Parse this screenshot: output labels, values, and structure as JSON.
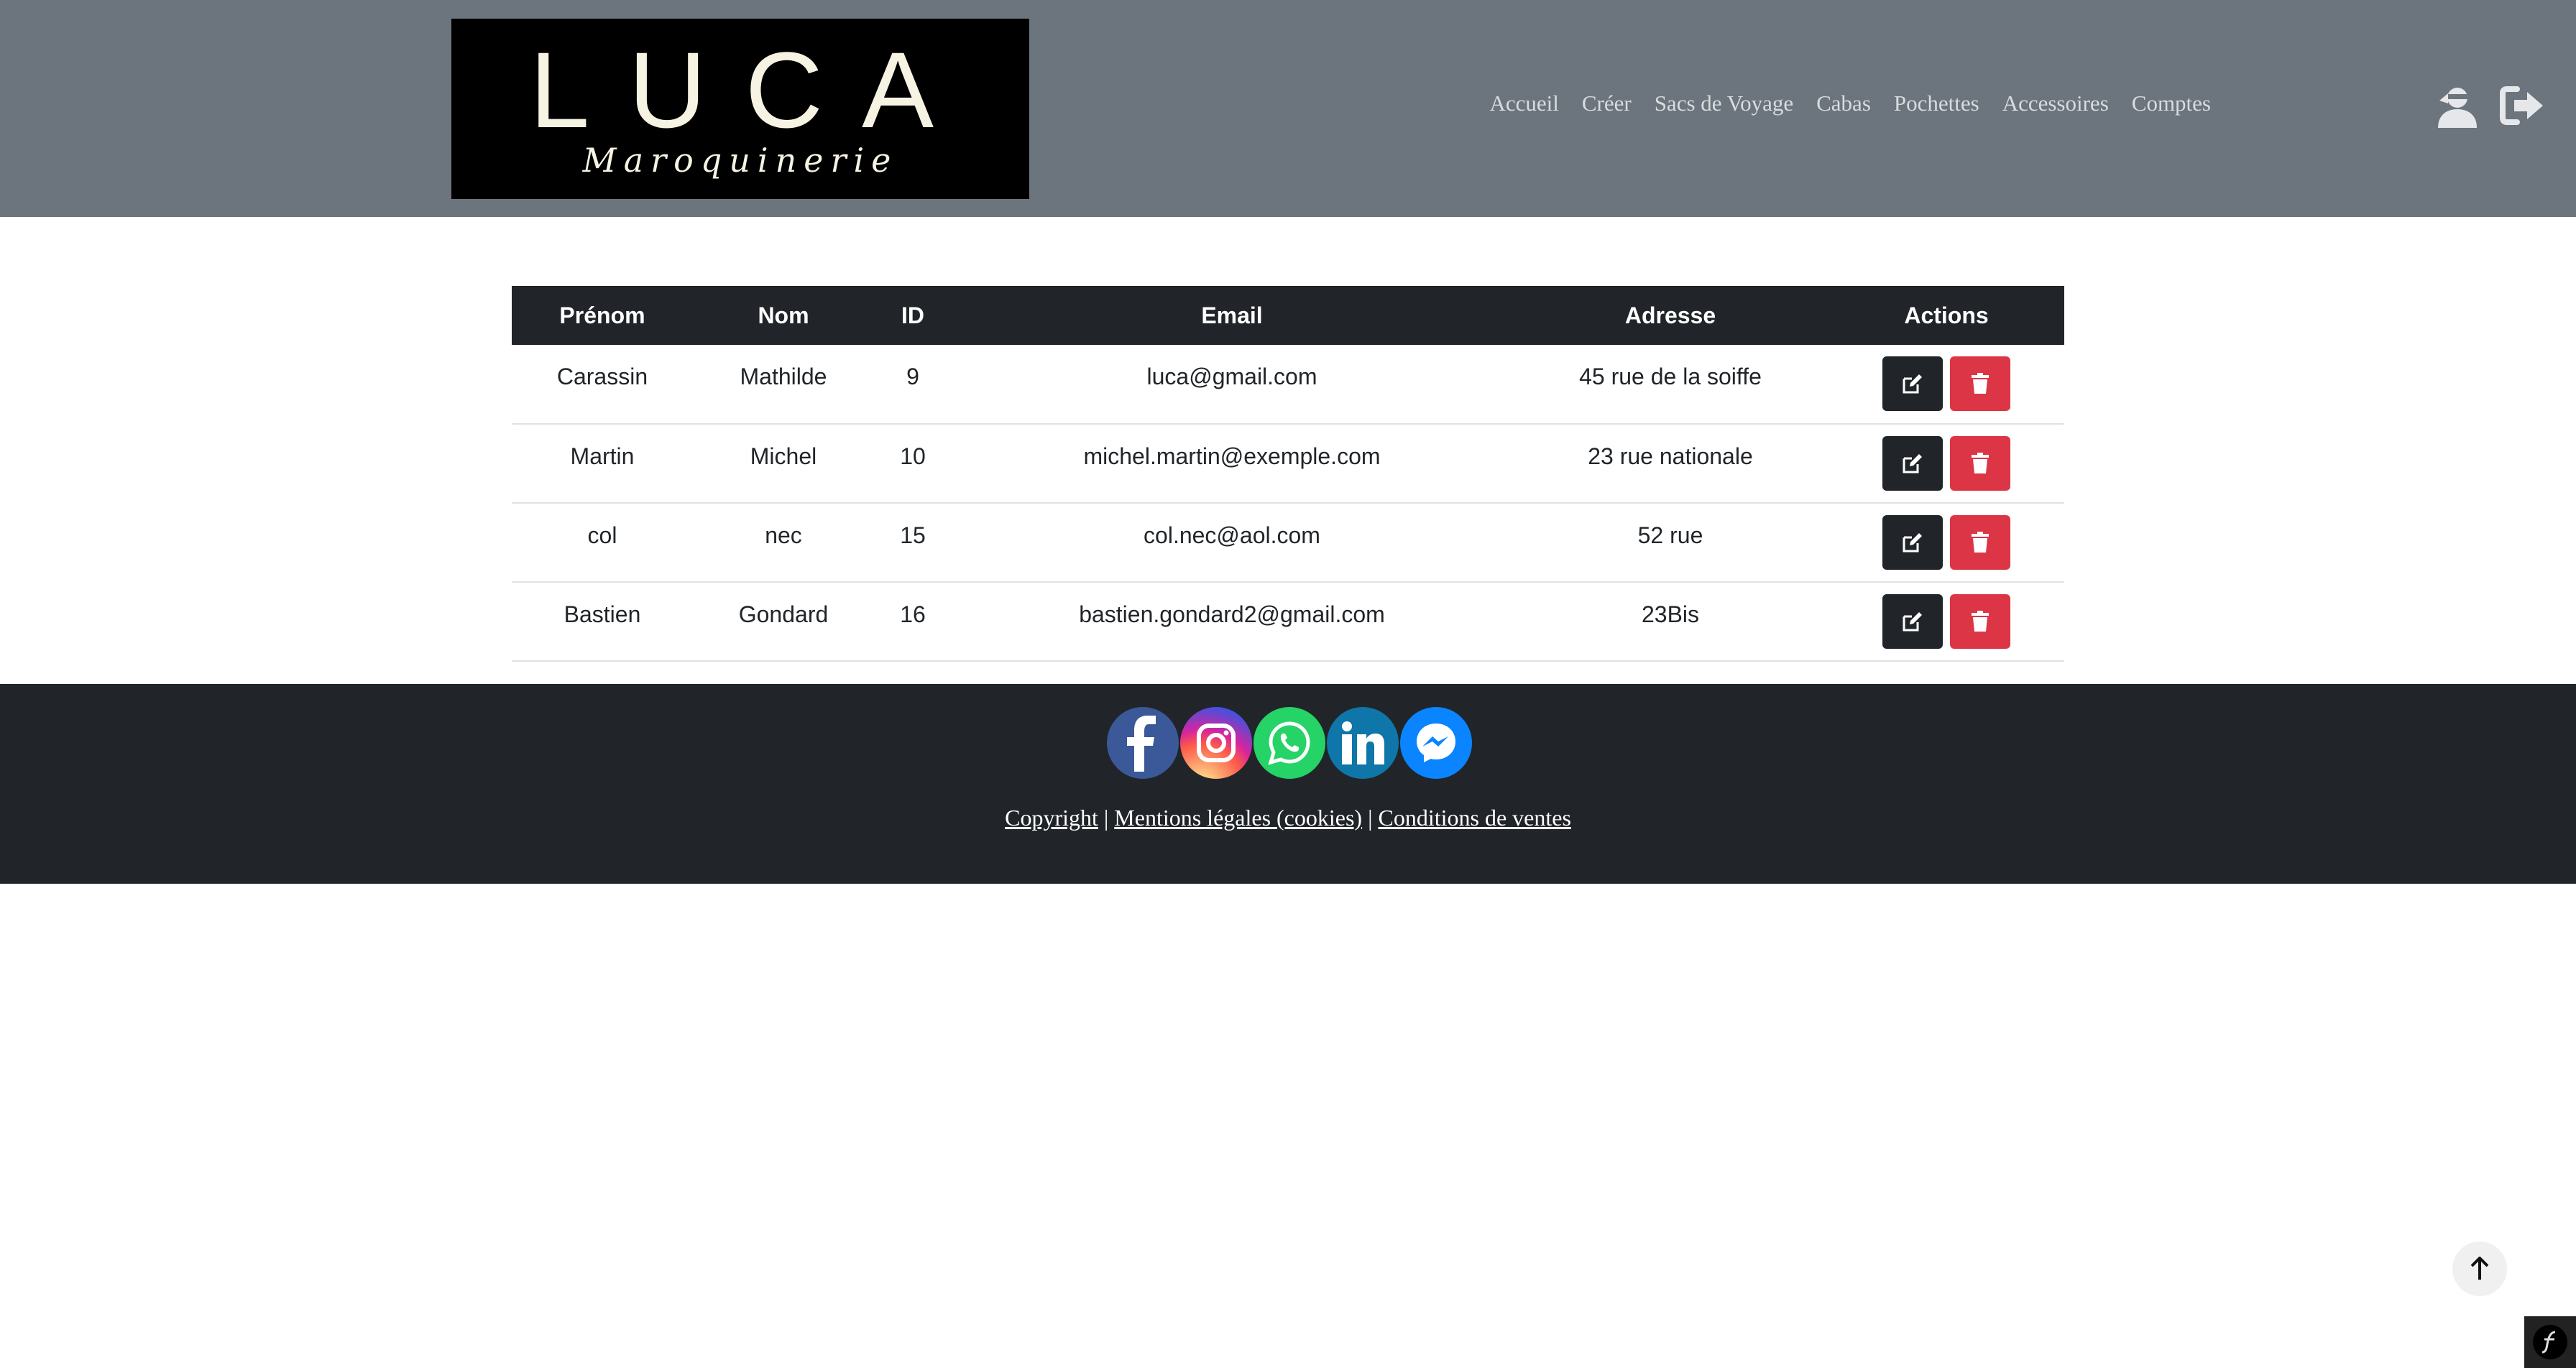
{
  "header": {
    "logo": {
      "main": "LUCA",
      "sub": "Maroquinerie"
    },
    "nav": [
      "Accueil",
      "Créer",
      "Sacs de Voyage",
      "Cabas",
      "Pochettes",
      "Accessoires",
      "Comptes"
    ],
    "icons": {
      "admin": "user-ninja-icon",
      "logout": "sign-out-icon"
    }
  },
  "table": {
    "headers": [
      "Prénom",
      "Nom",
      "ID",
      "Email",
      "Adresse",
      "Actions"
    ],
    "rows": [
      {
        "prenom": "Carassin",
        "nom": "Mathilde",
        "id": "9",
        "email": "luca@gmail.com",
        "adresse": "45 rue de la soiffe"
      },
      {
        "prenom": "Martin",
        "nom": "Michel",
        "id": "10",
        "email": "michel.martin@exemple.com",
        "adresse": "23 rue nationale"
      },
      {
        "prenom": "col",
        "nom": "nec",
        "id": "15",
        "email": "col.nec@aol.com",
        "adresse": "52 rue"
      },
      {
        "prenom": "Bastien",
        "nom": "Gondard",
        "id": "16",
        "email": "bastien.gondard2@gmail.com",
        "adresse": "23Bis"
      }
    ],
    "actions": {
      "edit": "edit-icon",
      "delete": "trash-icon"
    }
  },
  "footer": {
    "socials": [
      "facebook",
      "instagram",
      "whatsapp",
      "linkedin",
      "messenger"
    ],
    "links": {
      "copyright": "Copyright",
      "mentions": "Mentions légales (cookies)",
      "conditions": "Conditions de ventes",
      "separator": "|"
    }
  },
  "colors": {
    "header_bg": "#6c757d",
    "dark": "#212529",
    "danger": "#dc3545"
  }
}
